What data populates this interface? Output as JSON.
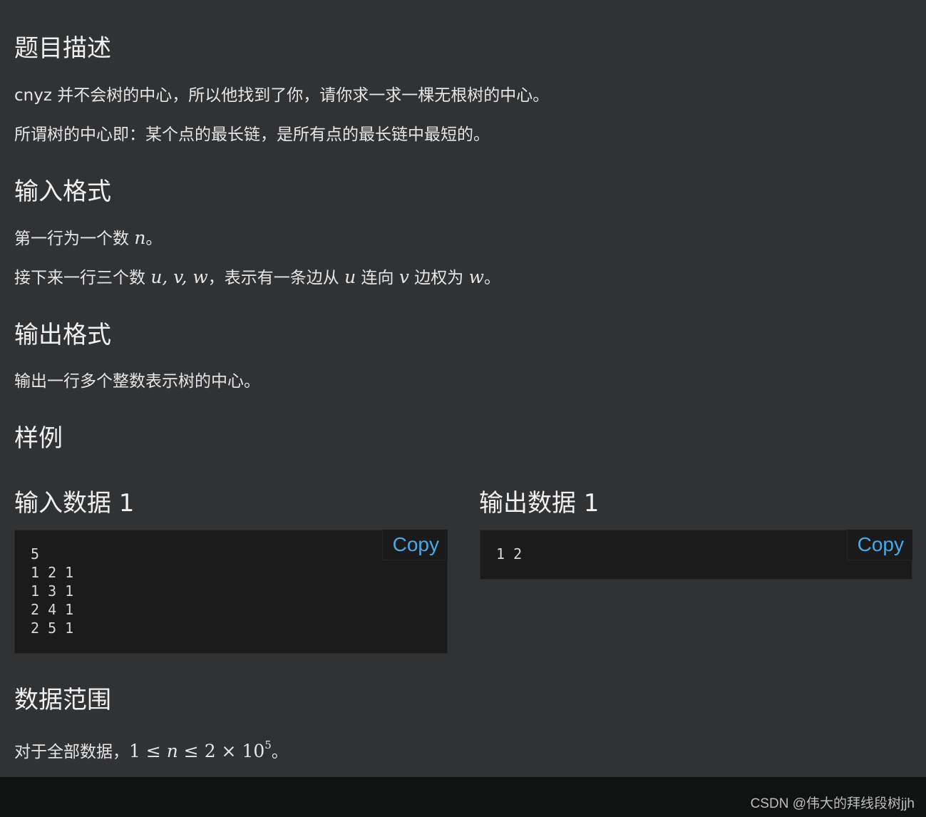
{
  "sections": {
    "description": {
      "title": "题目描述",
      "para1": "cnyz 并不会树的中心，所以他找到了你，请你求一求一棵无根树的中心。",
      "para2": "所谓树的中心即：某个点的最长链，是所有点的最长链中最短的。"
    },
    "input_format": {
      "title": "输入格式",
      "line1_text": "第一行为一个数 ",
      "line1_math": "n",
      "line1_end": "。",
      "line2_a": "接下来一行三个数 ",
      "line2_math1": "u, v, w",
      "line2_b": "，表示有一条边从 ",
      "line2_math2": "u",
      "line2_c": " 连向 ",
      "line2_math3": "v",
      "line2_d": " 边权为 ",
      "line2_math4": "w",
      "line2_e": "。"
    },
    "output_format": {
      "title": "输出格式",
      "para": "输出一行多个整数表示树的中心。"
    },
    "samples": {
      "title": "样例",
      "input_title": "输入数据 1",
      "output_title": "输出数据 1",
      "input_content": "5\n1 2 1\n1 3 1\n2 4 1\n2 5 1",
      "output_content": "1 2",
      "copy_label": "Copy"
    },
    "range": {
      "title": "数据范围",
      "text": "对于全部数据，",
      "math_a": "1 ≤ ",
      "math_n": "n",
      "math_b": " ≤ 2 × 10",
      "math_exp": "5",
      "end": "。"
    }
  },
  "footer": {
    "watermark": "CSDN @伟大的拜线段树jjh"
  },
  "colors": {
    "background": "#313234",
    "code_background": "#1b1b1b",
    "copy_link": "#4aa8e8",
    "footer": "#111212"
  }
}
